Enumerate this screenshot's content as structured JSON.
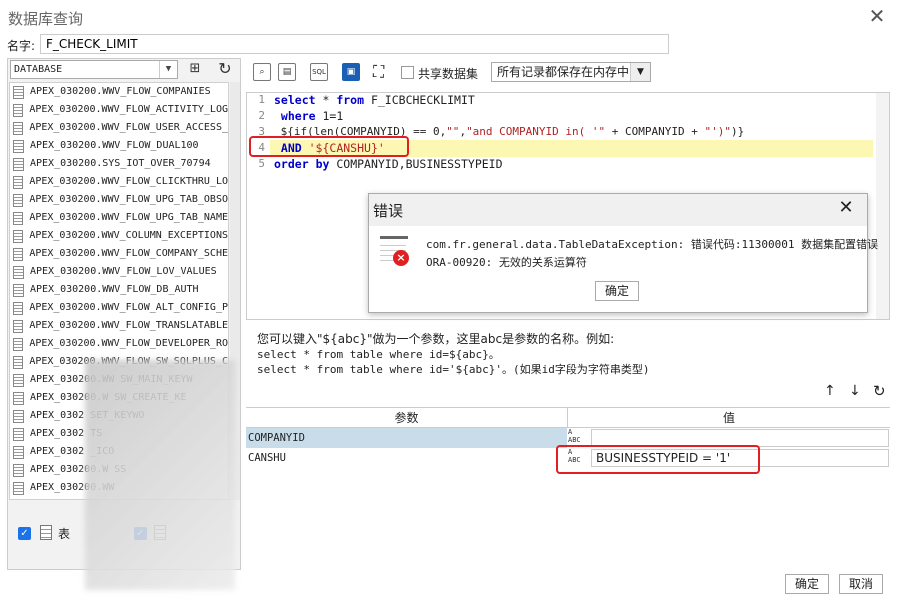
{
  "window": {
    "title": "数据库查询",
    "close_icon": "✕"
  },
  "name_field": {
    "label": "名字:",
    "value": "F_CHECK_LIMIT"
  },
  "left_panel": {
    "database_select": "DATABASE",
    "tables": [
      "APEX_030200.WWV_FLOW_COMPANIES",
      "APEX_030200.WWV_FLOW_ACTIVITY_LOG",
      "APEX_030200.WWV_FLOW_USER_ACCESS_",
      "APEX_030200.WWV_FLOW_DUAL100",
      "APEX_030200.SYS_IOT_OVER_70794",
      "APEX_030200.WWV_FLOW_CLICKTHRU_LO",
      "APEX_030200.WWV_FLOW_UPG_TAB_OBSO",
      "APEX_030200.WWV_FLOW_UPG_TAB_NAME",
      "APEX_030200.WWV_COLUMN_EXCEPTIONS",
      "APEX_030200.WWV_FLOW_COMPANY_SCHE",
      "APEX_030200.WWV_FLOW_LOV_VALUES",
      "APEX_030200.WWV_FLOW_DB_AUTH",
      "APEX_030200.WWV_FLOW_ALT_CONFIG_P",
      "APEX_030200.WWV_FLOW_TRANSLATABLE",
      "APEX_030200.WWV_FLOW_DEVELOPER_RO",
      "APEX_030200.WWV_FLOW_SW_SQLPLUS_C",
      "APEX_030200.WW   SW_MAIN_KEYW",
      "APEX_030200.W    SW_CREATE_KE",
      "APEX_0302        SET_KEYWO",
      "APEX_0302          TS",
      "APEX_0302          _ICO",
      "APEX_030200.W        SS",
      "APEX_030200.WW"
    ],
    "check_table_label": "表",
    "check_view_label": ""
  },
  "toolbar": {
    "share_label": "共享数据集",
    "mode_select": "所有记录都保存在内存中"
  },
  "editor": {
    "line_numbers": [
      "1",
      "2",
      "3",
      "4",
      "5"
    ],
    "line1": {
      "kw1": "select",
      "pl1": " * ",
      "kw2": "from",
      "pl2": " F_ICBCHECKLIMIT"
    },
    "line2": {
      "kw1": " where",
      "pl1": " 1=1"
    },
    "line3": {
      "pl1": " ${if(len(COMPANYID) == 0,",
      "str1": "\"\"",
      "pl2": ",",
      "str2": "\"and COMPANYID in( '\"",
      "pl3": " + COMPANYID + ",
      "str3": "\"')\"",
      "pl4": ")}"
    },
    "line4": {
      "kw1": " AND",
      "str1": " '${CANSHU}'"
    },
    "line5": {
      "kw1": "order",
      "pl1": " ",
      "kw2": "by",
      "pl2": " COMPANYID,BUSINESSTYPEID"
    }
  },
  "help": {
    "line1": "您可以键入\"${abc}\"做为一个参数，这里abc是参数的名称。例如:",
    "line2": "select * from table where id=${abc}。",
    "line3": "select * from table where id='${abc}'。(如果id字段为字符串类型)"
  },
  "params": {
    "header_param": "参数",
    "header_value": "值",
    "rows": [
      {
        "name": "COMPANYID",
        "value": ""
      },
      {
        "name": "CANSHU",
        "value": "BUSINESSTYPEID = '1'"
      }
    ]
  },
  "dialog": {
    "title": "错误",
    "message_line1": "com.fr.general.data.TableDataException: 错误代码:11300001 数据集配置错误",
    "message_line2": "ORA-00920: 无效的关系运算符",
    "ok_label": "确定"
  },
  "footer": {
    "ok_label": "确定",
    "cancel_label": "取消"
  },
  "colors": {
    "keyword": "#0000cc",
    "string": "#b22222",
    "highlight": "#fcf8b4",
    "annotation_red": "#e02020",
    "check_blue": "#1a73e8"
  }
}
